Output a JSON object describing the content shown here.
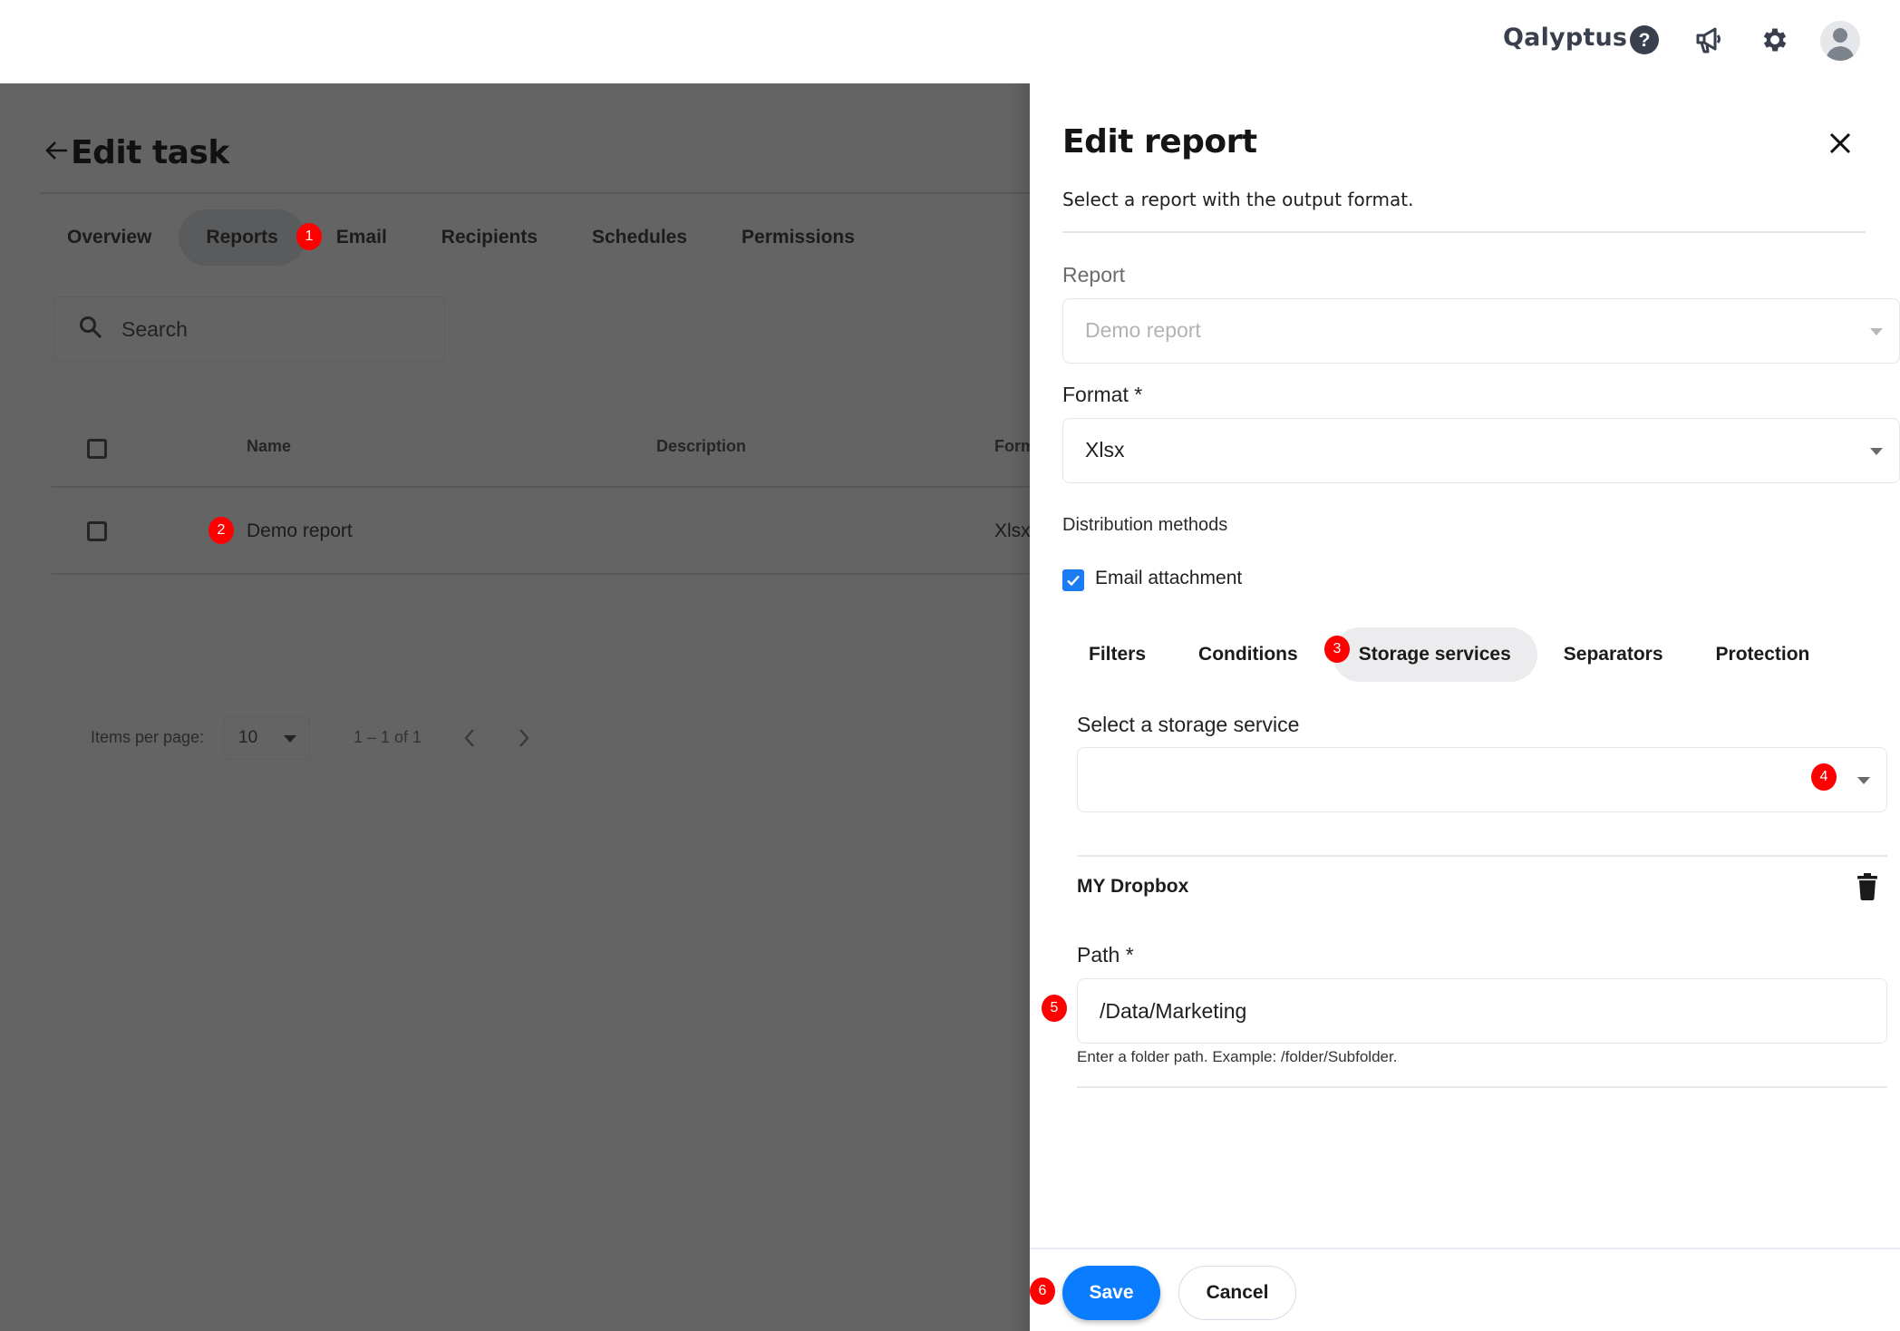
{
  "topbar": {
    "brand": "Qalyptus",
    "icons": [
      "help-icon",
      "announcement-icon",
      "settings-icon",
      "avatar"
    ]
  },
  "page": {
    "title": "Edit task",
    "tabs": [
      {
        "label": "Overview",
        "active": false
      },
      {
        "label": "Reports",
        "active": true
      },
      {
        "label": "Email",
        "active": false
      },
      {
        "label": "Recipients",
        "active": false
      },
      {
        "label": "Schedules",
        "active": false
      },
      {
        "label": "Permissions",
        "active": false
      }
    ],
    "search": {
      "placeholder": "Search"
    },
    "table": {
      "columns": [
        "Name",
        "Description",
        "Form"
      ],
      "rows": [
        {
          "name": "Demo report",
          "description": "",
          "format": "Xlsx"
        }
      ]
    },
    "pager": {
      "items_per_page_label": "Items per page:",
      "items_per_page": "10",
      "range": "1 – 1 of 1"
    }
  },
  "panel": {
    "title": "Edit report",
    "subtitle": "Select a report with the output format.",
    "report_label": "Report",
    "report_value": "Demo report",
    "format_label": "Format *",
    "format_value": "Xlsx",
    "distribution_label": "Distribution methods",
    "email_attachment_label": "Email attachment",
    "email_attachment_checked": true,
    "subtabs": [
      {
        "label": "Filters",
        "active": false
      },
      {
        "label": "Conditions",
        "active": false
      },
      {
        "label": "Storage services",
        "active": true
      },
      {
        "label": "Separators",
        "active": false
      },
      {
        "label": "Protection",
        "active": false
      }
    ],
    "storage_label": "Select a storage service",
    "storage_value": "",
    "service": {
      "name": "MY Dropbox",
      "path_label": "Path *",
      "path_value": "/Data/Marketing",
      "path_hint": "Enter a folder path. Example: /folder/Subfolder."
    },
    "save_label": "Save",
    "cancel_label": "Cancel"
  },
  "markers": [
    "1",
    "2",
    "3",
    "4",
    "5",
    "6"
  ],
  "colors": {
    "accent": "#0a7cff",
    "marker": "#ff0000",
    "overlay": "#646464"
  }
}
